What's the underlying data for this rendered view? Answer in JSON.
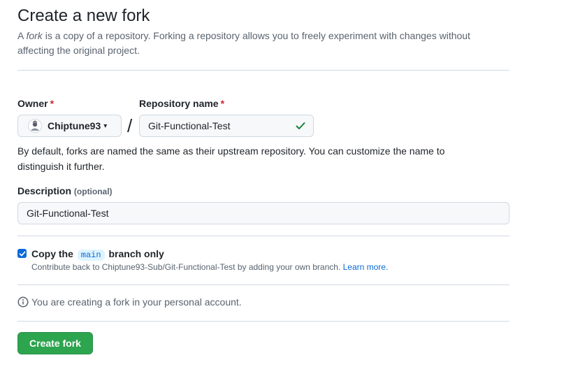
{
  "page": {
    "title": "Create a new fork",
    "subtitle_prefix": "A ",
    "subtitle_em": "fork",
    "subtitle_rest": " is a copy of a repository. Forking a repository allows you to freely experiment with changes without affecting the original project."
  },
  "owner": {
    "label": "Owner",
    "required_mark": "*",
    "value": "Chiptune93"
  },
  "repo": {
    "label": "Repository name",
    "required_mark": "*",
    "value": "Git-Functional-Test",
    "separator": "/"
  },
  "help_text": "By default, forks are named the same as their upstream repository. You can customize the name to distinguish it further.",
  "description": {
    "label": "Description",
    "optional": "(optional)",
    "value": "Git-Functional-Test"
  },
  "copy_branch": {
    "checked": true,
    "label_before": "Copy the",
    "branch": "main",
    "label_after": "branch only",
    "note": "Contribute back to Chiptune93-Sub/Git-Functional-Test by adding your own branch.",
    "learn_more": "Learn more."
  },
  "info_text": "You are creating a fork in your personal account.",
  "submit_label": "Create fork",
  "colors": {
    "primary_green": "#2da44e",
    "link_blue": "#0969da",
    "success_check": "#1a7f37",
    "required_red": "#d1242f"
  },
  "icons": {
    "owner_avatar": "avatar-icon",
    "dropdown": "caret-down-icon",
    "valid": "check-icon",
    "info": "info-icon"
  }
}
